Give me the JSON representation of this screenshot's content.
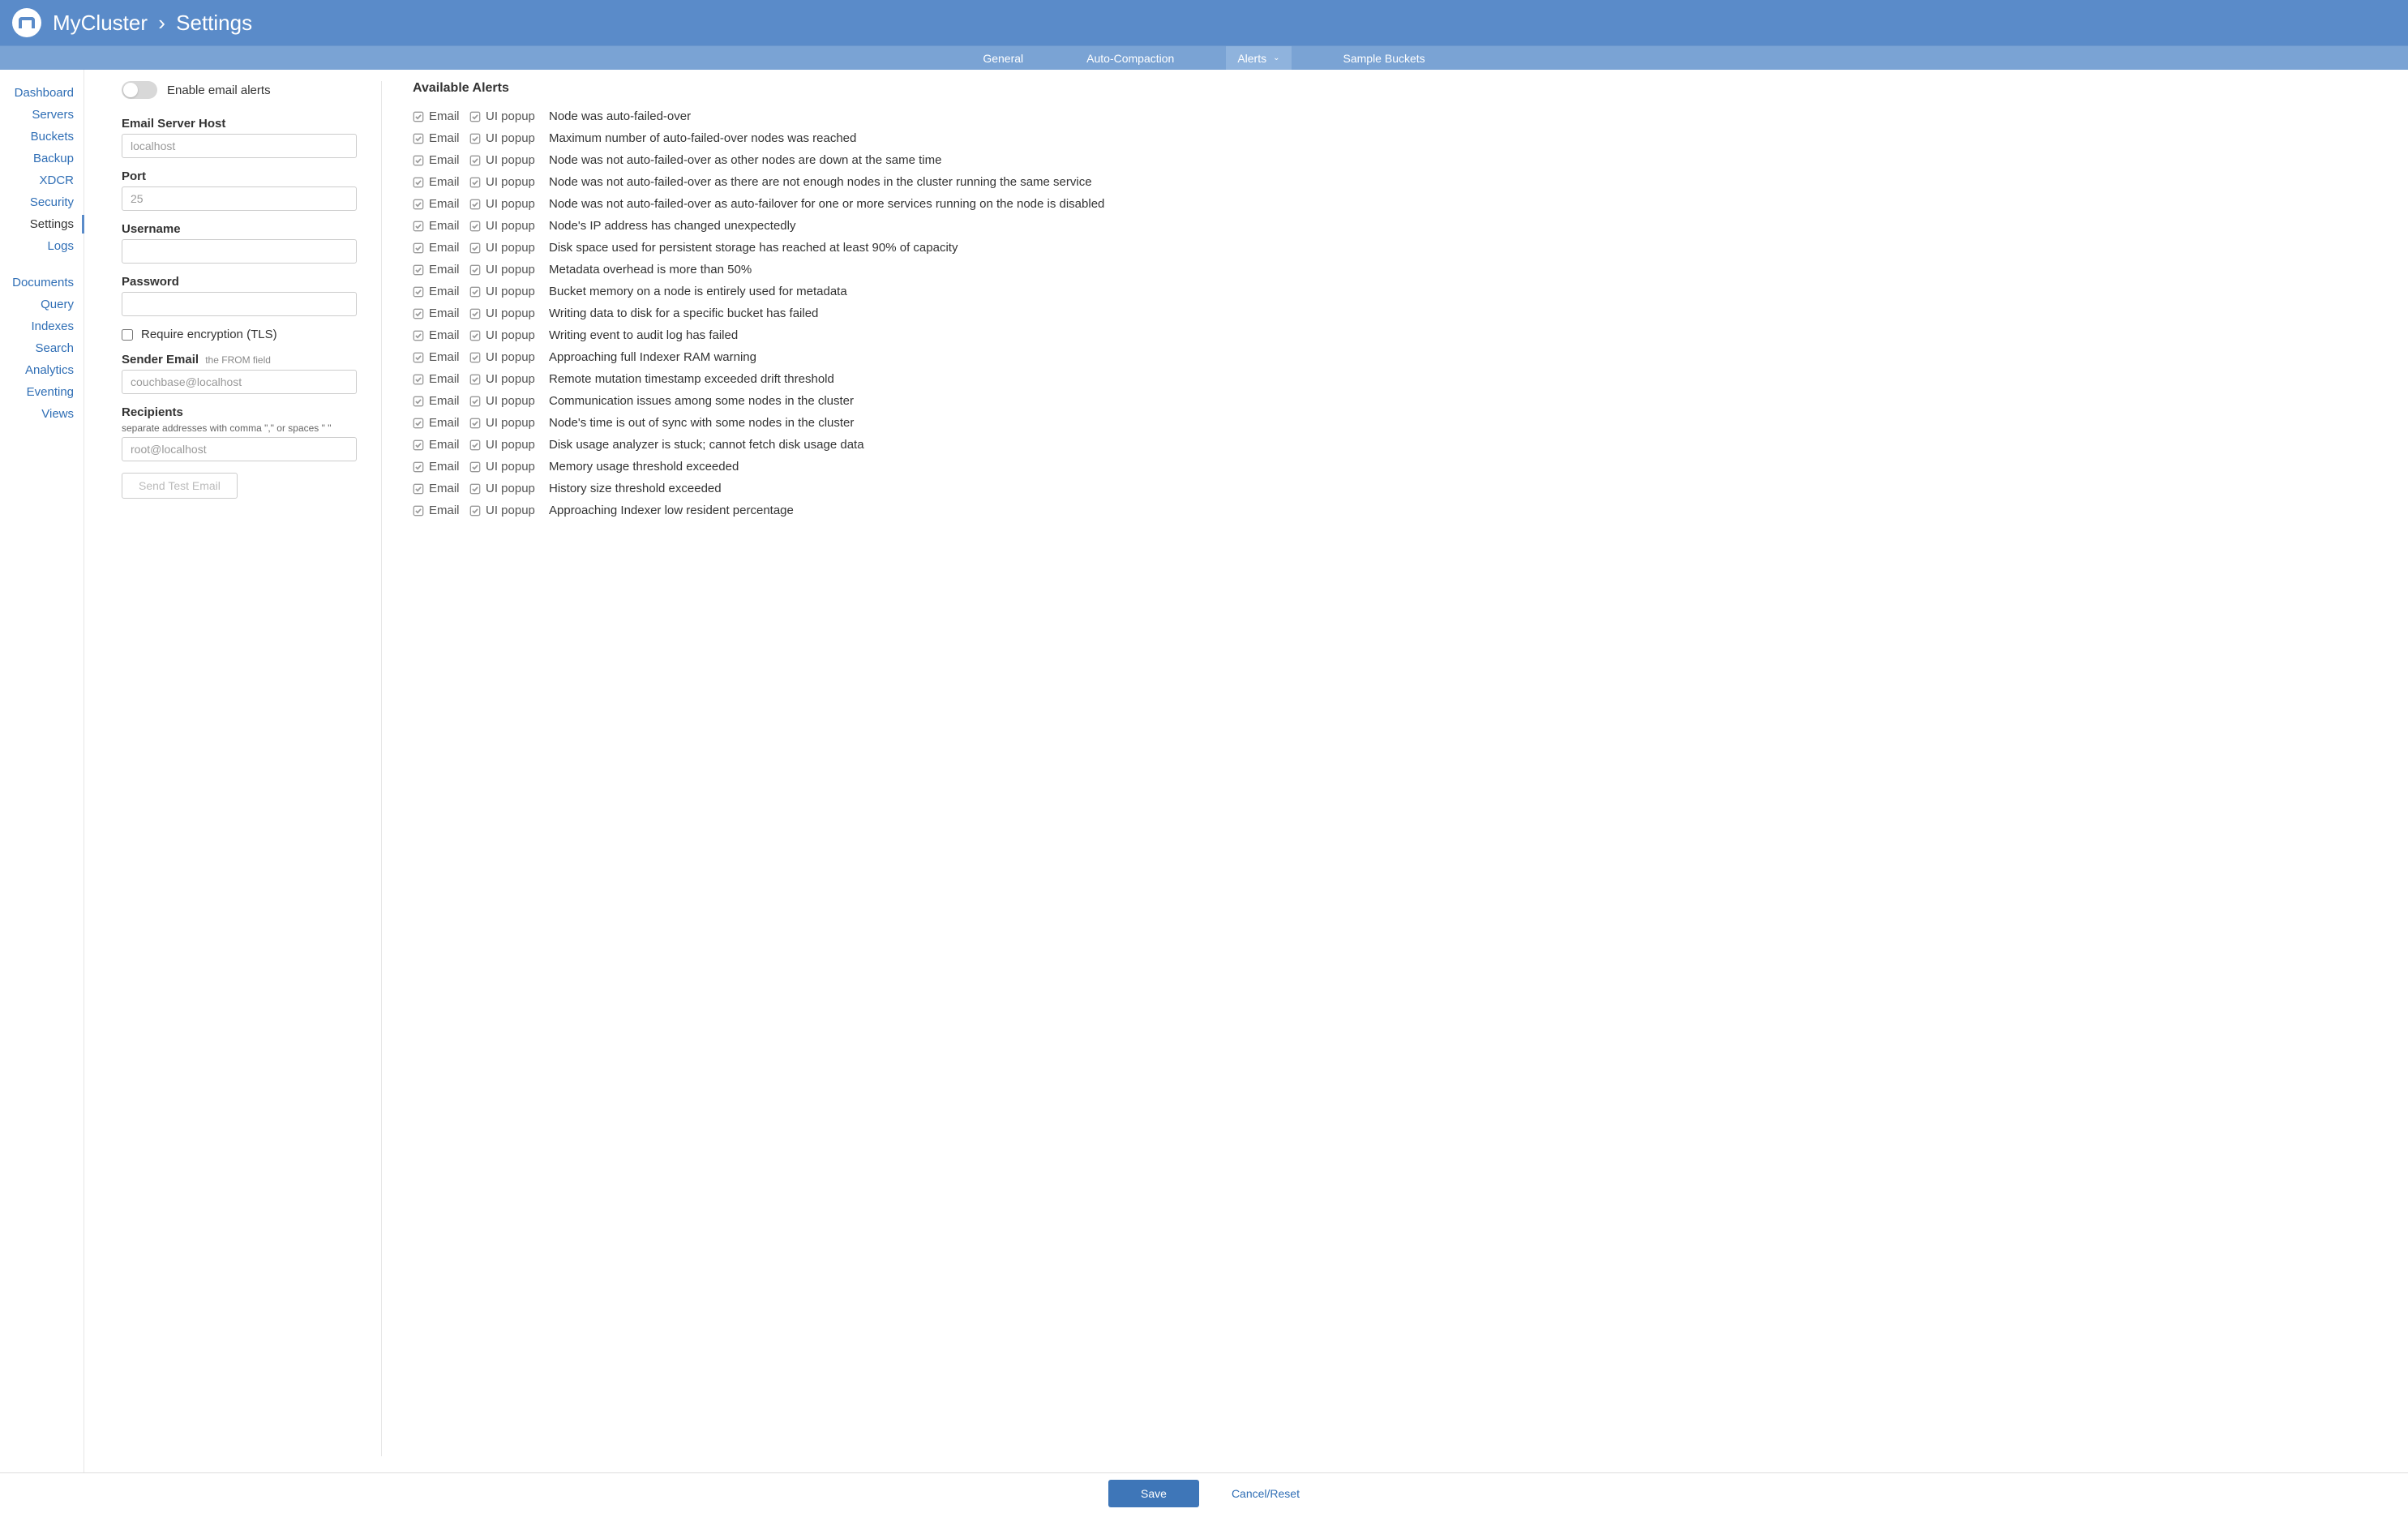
{
  "header": {
    "cluster_name": "MyCluster",
    "page_title": "Settings"
  },
  "subnav": {
    "items": [
      {
        "label": "General",
        "active": false
      },
      {
        "label": "Auto-Compaction",
        "active": false
      },
      {
        "label": "Alerts",
        "active": true,
        "dropdown": true
      },
      {
        "label": "Sample Buckets",
        "active": false
      }
    ]
  },
  "sidebar": {
    "group1": [
      {
        "label": "Dashboard"
      },
      {
        "label": "Servers"
      },
      {
        "label": "Buckets"
      },
      {
        "label": "Backup"
      },
      {
        "label": "XDCR"
      },
      {
        "label": "Security"
      },
      {
        "label": "Settings",
        "active": true
      },
      {
        "label": "Logs"
      }
    ],
    "group2": [
      {
        "label": "Documents"
      },
      {
        "label": "Query"
      },
      {
        "label": "Indexes"
      },
      {
        "label": "Search"
      },
      {
        "label": "Analytics"
      },
      {
        "label": "Eventing"
      },
      {
        "label": "Views"
      }
    ]
  },
  "form": {
    "toggle_label": "Enable email alerts",
    "host_label": "Email Server Host",
    "host_value": "localhost",
    "port_label": "Port",
    "port_value": "25",
    "username_label": "Username",
    "username_value": "",
    "password_label": "Password",
    "password_value": "",
    "tls_label": "Require encryption (TLS)",
    "sender_label": "Sender Email",
    "sender_hint": "the FROM field",
    "sender_value": "couchbase@localhost",
    "recipients_label": "Recipients",
    "recipients_hint": "separate addresses with comma \",\" or spaces \" \"",
    "recipients_value": "root@localhost",
    "send_test_label": "Send Test Email"
  },
  "alerts": {
    "title": "Available Alerts",
    "email_label": "Email",
    "popup_label": "UI popup",
    "items": [
      {
        "desc": "Node was auto-failed-over"
      },
      {
        "desc": "Maximum number of auto-failed-over nodes was reached"
      },
      {
        "desc": "Node was not auto-failed-over as other nodes are down at the same time"
      },
      {
        "desc": "Node was not auto-failed-over as there are not enough nodes in the cluster running the same service"
      },
      {
        "desc": "Node was not auto-failed-over as auto-failover for one or more services running on the node is disabled"
      },
      {
        "desc": "Node's IP address has changed unexpectedly"
      },
      {
        "desc": "Disk space used for persistent storage has reached at least 90% of capacity"
      },
      {
        "desc": "Metadata overhead is more than 50%"
      },
      {
        "desc": "Bucket memory on a node is entirely used for metadata"
      },
      {
        "desc": "Writing data to disk for a specific bucket has failed"
      },
      {
        "desc": "Writing event to audit log has failed"
      },
      {
        "desc": "Approaching full Indexer RAM warning"
      },
      {
        "desc": "Remote mutation timestamp exceeded drift threshold"
      },
      {
        "desc": "Communication issues among some nodes in the cluster"
      },
      {
        "desc": "Node's time is out of sync with some nodes in the cluster"
      },
      {
        "desc": "Disk usage analyzer is stuck; cannot fetch disk usage data"
      },
      {
        "desc": "Memory usage threshold exceeded"
      },
      {
        "desc": "History size threshold exceeded"
      },
      {
        "desc": "Approaching Indexer low resident percentage"
      }
    ]
  },
  "footer": {
    "save_label": "Save",
    "cancel_label": "Cancel/Reset"
  }
}
